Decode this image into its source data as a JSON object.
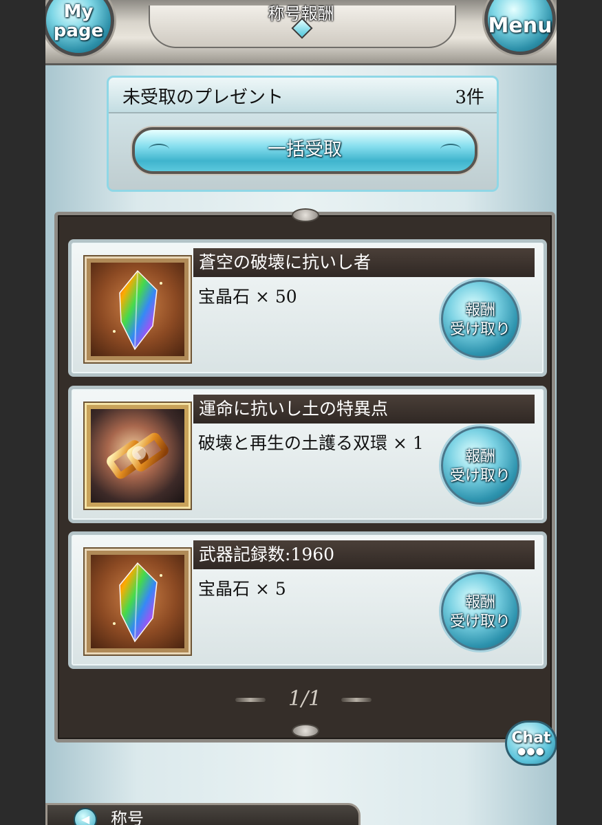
{
  "header": {
    "title": "称号報酬",
    "mypage_label": "My page",
    "menu_label": "Menu"
  },
  "presents": {
    "label": "未受取のプレゼント",
    "count": "3件",
    "bulk_button": "一括受取"
  },
  "rewards": [
    {
      "title": "蒼空の破壊に抗いし者",
      "reward": "宝晶石 × 50",
      "icon": "rainbow-crystal-icon",
      "claim_label": "報酬 受け取り"
    },
    {
      "title": "運命に抗いし土の特異点",
      "reward": "破壊と再生の土護る双環 × 1",
      "icon": "twin-ring-icon",
      "claim_label": "報酬 受け取り"
    },
    {
      "title": "武器記録数:1960",
      "reward": "宝晶石 × 5",
      "icon": "rainbow-crystal-icon",
      "claim_label": "報酬 受け取り"
    }
  ],
  "pager": {
    "text": "1/1"
  },
  "chat_label": "Chat",
  "bottom_nav": {
    "label": "称号"
  },
  "colors": {
    "accent": "#4fc6dc",
    "panel": "#352e29"
  }
}
